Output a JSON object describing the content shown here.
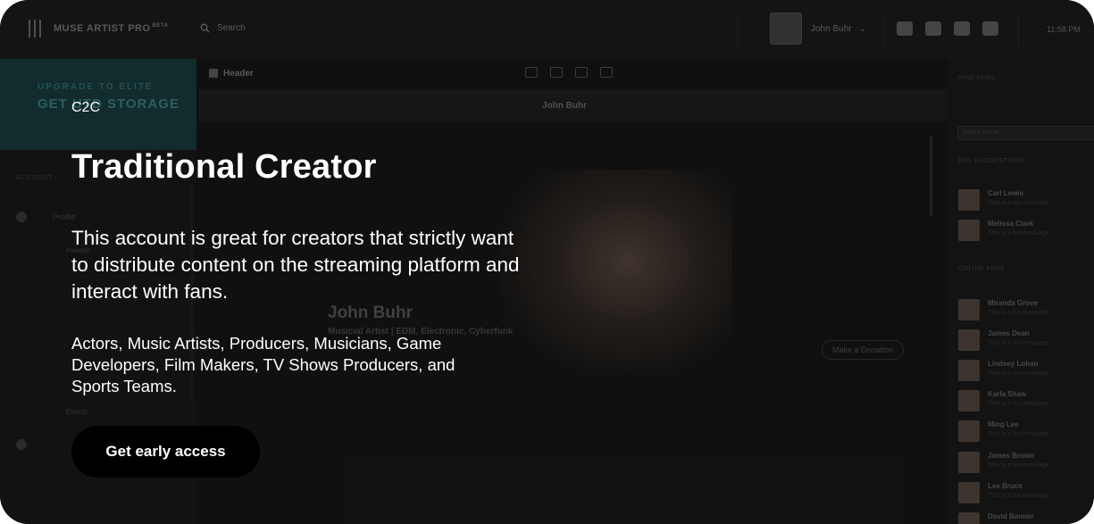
{
  "overlay": {
    "eyebrow": "C2C",
    "title": "Traditional Creator",
    "description": "This account is great for creators that strictly want to distribute content on the streaming platform and interact with fans.",
    "types": "Actors, Music Artists, Producers, Musicians, Game Developers, Film Makers, TV Shows Producers, and Sports Teams.",
    "cta_label": "Get early access"
  },
  "app": {
    "logo": "MUSE ARTIST PRO",
    "logo_badge": "BETA",
    "search_label": "Search",
    "user_name": "John Buhr",
    "clock": "11:58 PM",
    "upgrade_line1": "UPGRADE TO ELITE",
    "upgrade_line2": "GET UTD STORAGE",
    "sidebar": {
      "account": "ACCOUNT",
      "profile": "Profile",
      "header": "Header",
      "events": "Events"
    },
    "editor": {
      "header_label": "Header",
      "page_name": "John Buhr",
      "hero_name": "John Buhr",
      "hero_subtitle": "Musicial Artist | EDM, Electronic, Cyberfunk",
      "donate_label": "Make a Donation"
    },
    "right_panel": {
      "find_fans": "FIND FANS",
      "find_placeholder": "Find a friend",
      "suggestions": "FAN SUGGESTIONS",
      "online": "ONLINE FANS",
      "status": "This is a fun message",
      "suggested_fans": [
        "Carl Lewis",
        "Melissa Clark"
      ],
      "online_fans": [
        "Miranda Grove",
        "James Dean",
        "Lindsey Lohan",
        "Karla Shaw",
        "Ming Lee",
        "James Brown",
        "Lee Bruce",
        "David Banner"
      ]
    }
  },
  "colors": {
    "card_bg": "#1b1b1b",
    "cta_bg": "#000000",
    "cta_text": "#ffffff",
    "accent_teal": "#1f4a4d"
  }
}
